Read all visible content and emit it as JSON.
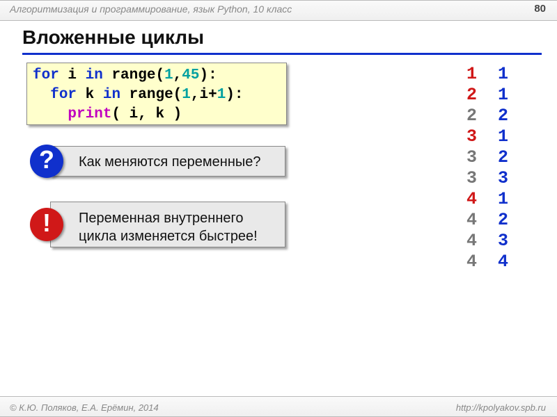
{
  "header": {
    "course": "Алгоритмизация и программирование, язык Python, 10 класс",
    "page": "80"
  },
  "title": "Вложенные циклы",
  "code": {
    "line1": {
      "a": "for",
      "b": " i ",
      "c": "in",
      "d": " range(",
      "n1": "1",
      "comma": ",",
      "n2": "45",
      "e": "):"
    },
    "line2": {
      "pad": "  ",
      "a": "for",
      "b": " k ",
      "c": "in",
      "d": " range(",
      "n1": "1",
      "comma": ",i+",
      "n2": "1",
      "e": "):"
    },
    "line3": {
      "pad": "    ",
      "fn": "print",
      "args": "( i, k )"
    }
  },
  "callouts": {
    "q_badge": "?",
    "q_text": "Как меняются переменные?",
    "x_badge": "!",
    "x_text": "Переменная внутреннего цикла изменяется быстрее!"
  },
  "output": [
    {
      "i": "1",
      "ic": "c-red",
      "k": "1",
      "kc": "c-navy"
    },
    {
      "i": "2",
      "ic": "c-red",
      "k": "1",
      "kc": "c-navy"
    },
    {
      "i": "2",
      "ic": "c-gray",
      "k": "2",
      "kc": "c-navy"
    },
    {
      "i": "3",
      "ic": "c-red",
      "k": "1",
      "kc": "c-navy"
    },
    {
      "i": "3",
      "ic": "c-gray",
      "k": "2",
      "kc": "c-navy"
    },
    {
      "i": "3",
      "ic": "c-gray",
      "k": "3",
      "kc": "c-navy"
    },
    {
      "i": "4",
      "ic": "c-red",
      "k": "1",
      "kc": "c-navy"
    },
    {
      "i": "4",
      "ic": "c-gray",
      "k": "2",
      "kc": "c-navy"
    },
    {
      "i": "4",
      "ic": "c-gray",
      "k": "3",
      "kc": "c-navy"
    },
    {
      "i": "4",
      "ic": "c-gray",
      "k": "4",
      "kc": "c-navy"
    }
  ],
  "footer": {
    "left": "© К.Ю. Поляков, Е.А. Ерёмин, 2014",
    "right": "http://kpolyakov.spb.ru"
  }
}
